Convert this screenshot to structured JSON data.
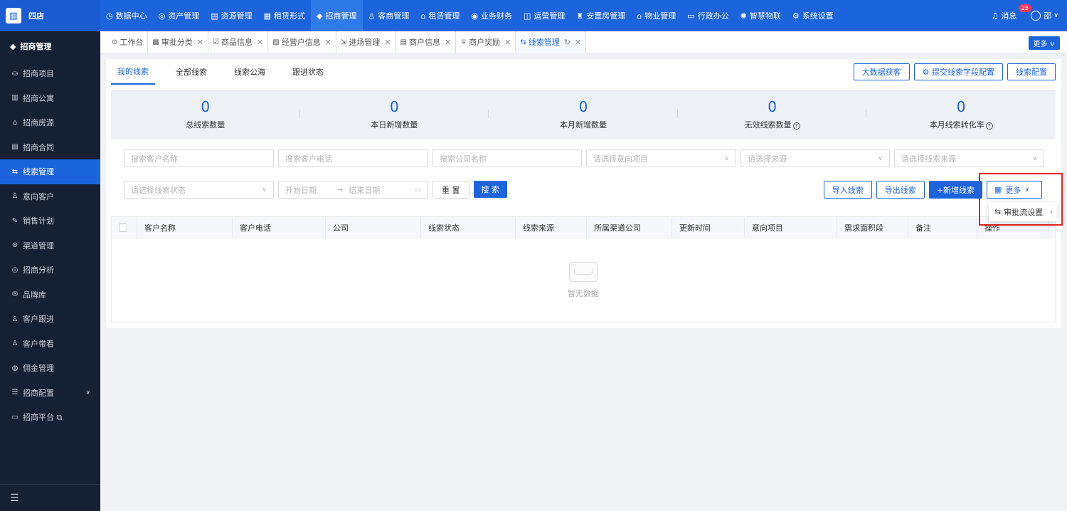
{
  "app": {
    "name": "四店"
  },
  "topnav": [
    {
      "icon": "◷",
      "label": "数据中心"
    },
    {
      "icon": "◎",
      "label": "资产管理"
    },
    {
      "icon": "▤",
      "label": "资源管理"
    },
    {
      "icon": "▦",
      "label": "租赁形式"
    },
    {
      "icon": "◆",
      "label": "招商管理",
      "active": true
    },
    {
      "icon": "♙",
      "label": "客商管理"
    },
    {
      "icon": "⌂",
      "label": "租赁管理"
    },
    {
      "icon": "◉",
      "label": "业务财务"
    },
    {
      "icon": "◫",
      "label": "运营管理"
    },
    {
      "icon": "♜",
      "label": "安置房管理"
    },
    {
      "icon": "⌂",
      "label": "物业管理"
    },
    {
      "icon": "▭",
      "label": "行政办公"
    },
    {
      "icon": "✺",
      "label": "智慧物联"
    },
    {
      "icon": "⚙",
      "label": "系统设置"
    }
  ],
  "topright": {
    "msg_label": "消息",
    "msg_count": "28",
    "user": "邵"
  },
  "sidebar": {
    "header": "招商管理",
    "items": [
      {
        "icon": "⛀",
        "label": "招商项目"
      },
      {
        "icon": "▥",
        "label": "招商公寓"
      },
      {
        "icon": "⌂",
        "label": "招商房源"
      },
      {
        "icon": "▤",
        "label": "招商合同"
      },
      {
        "icon": "⇆",
        "label": "线索管理",
        "active": true
      },
      {
        "icon": "♙",
        "label": "意向客户"
      },
      {
        "icon": "✎",
        "label": "销售计划"
      },
      {
        "icon": "⊛",
        "label": "渠道管理"
      },
      {
        "icon": "◎",
        "label": "招商分析"
      },
      {
        "icon": "®",
        "label": "品牌库"
      },
      {
        "icon": "♙",
        "label": "客户跟进"
      },
      {
        "icon": "♙",
        "label": "客户带看"
      },
      {
        "icon": "◍",
        "label": "佣金管理"
      },
      {
        "icon": "☰",
        "label": "招商配置",
        "chev": true
      },
      {
        "icon": "▭",
        "label": "招商平台 ⧉"
      }
    ],
    "footer_icon": "☰"
  },
  "tabs": [
    {
      "icon": "⊙",
      "label": "工作台",
      "closable": false
    },
    {
      "icon": "▩",
      "label": "审批分类",
      "closable": true
    },
    {
      "icon": "☑",
      "label": "商品信息",
      "closable": true
    },
    {
      "icon": "▨",
      "label": "经营户信息",
      "closable": true
    },
    {
      "icon": "⇲",
      "label": "进场管理",
      "closable": true
    },
    {
      "icon": "▤",
      "label": "商户信息",
      "closable": true
    },
    {
      "icon": "♕",
      "label": "商户奖励",
      "closable": true
    },
    {
      "icon": "⇆",
      "label": "线索管理",
      "closable": true,
      "active": true
    }
  ],
  "tabs_more": "更多 ∨",
  "subtabs": [
    "我的线索",
    "全部线索",
    "线索公海",
    "跟进状态"
  ],
  "header_buttons": {
    "big_data": "大数据获客",
    "submit_config": "⚙  提交线索字段配置",
    "clue_config": "线索配置"
  },
  "stats": [
    {
      "value": "0",
      "label": "总线索数量",
      "help": false
    },
    {
      "value": "0",
      "label": "本日新增数量",
      "help": false
    },
    {
      "value": "0",
      "label": "本月新增数量",
      "help": false
    },
    {
      "value": "0",
      "label": "无效线索数量",
      "help": true
    },
    {
      "value": "0",
      "label": "本月线索转化率",
      "help": true
    }
  ],
  "filters": {
    "customer_name": "搜索客户名称",
    "customer_phone": "搜索客户电话",
    "company_name": "搜索公司名称",
    "project": "请选择意向项目",
    "source": "请选择来源",
    "clue_source": "请选择线索来源",
    "clue_status": "请选择线索状态",
    "start_date": "开始日期",
    "end_date": "结束日期",
    "date_sep": "→",
    "reset": "重 置",
    "search": "搜 索"
  },
  "actions": {
    "import": "导入线索",
    "export": "导出线索",
    "add": "+新增线索",
    "more": "更多"
  },
  "table": {
    "columns": [
      "客户名称",
      "客户电话",
      "公司",
      "线索状态",
      "线索来源",
      "所属渠道公司",
      "更新时间",
      "意向项目",
      "需求面积段",
      "备注",
      "操作"
    ],
    "empty": "暂无数据"
  },
  "dropdown": {
    "item": "审批流设置"
  }
}
